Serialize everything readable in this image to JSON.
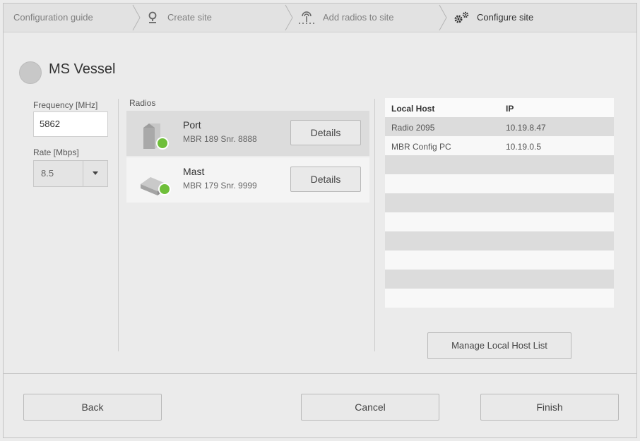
{
  "breadcrumb": {
    "steps": [
      {
        "label": "Configuration guide",
        "icon": "none"
      },
      {
        "label": "Create site",
        "icon": "location-pin-icon"
      },
      {
        "label": "Add radios to site",
        "icon": "radio-antenna-icon"
      },
      {
        "label": "Configure site",
        "icon": "gears-icon"
      }
    ]
  },
  "site": {
    "name": "MS Vessel"
  },
  "frequency": {
    "label": "Frequency [MHz]",
    "value": "5862"
  },
  "rate": {
    "label": "Rate [Mbps]",
    "value": "8.5"
  },
  "radios": {
    "label": "Radios",
    "items": [
      {
        "name": "Port",
        "detail": "MBR 189 Snr. 8888",
        "button": "Details",
        "status_color": "#6fbf3a"
      },
      {
        "name": "Mast",
        "detail": "MBR 179 Snr. 9999",
        "button": "Details",
        "status_color": "#6fbf3a"
      }
    ]
  },
  "hosts": {
    "columns": [
      "Local Host",
      "IP"
    ],
    "rows": [
      [
        "Radio 2095",
        "10.19.8.47"
      ],
      [
        "MBR Config PC",
        "10.19.0.5"
      ],
      [
        "",
        ""
      ],
      [
        "",
        ""
      ],
      [
        "",
        ""
      ],
      [
        "",
        ""
      ],
      [
        "",
        ""
      ],
      [
        "",
        ""
      ],
      [
        "",
        ""
      ],
      [
        "",
        ""
      ]
    ],
    "manage_button": "Manage Local Host List"
  },
  "footer": {
    "back": "Back",
    "cancel": "Cancel",
    "finish": "Finish"
  }
}
